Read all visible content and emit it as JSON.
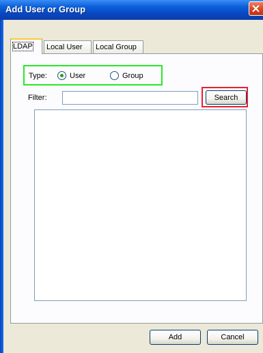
{
  "window": {
    "title": "Add User or Group"
  },
  "tabs": [
    {
      "label": "LDAP",
      "active": true
    },
    {
      "label": "Local User",
      "active": false
    },
    {
      "label": "Local Group",
      "active": false
    }
  ],
  "type_selector": {
    "label": "Type:",
    "options": [
      {
        "label": "User",
        "selected": true
      },
      {
        "label": "Group",
        "selected": false
      }
    ]
  },
  "filter": {
    "label": "Filter:",
    "value": "",
    "placeholder": ""
  },
  "buttons": {
    "search_label": "Search",
    "add_label": "Add",
    "cancel_label": "Cancel"
  },
  "results": {
    "items": []
  },
  "colors": {
    "highlight_type_group": "#27e827",
    "highlight_search_button": "#e8202a",
    "dialog_background": "#ece9d8",
    "titlebar": "#0a5fd8"
  },
  "icons": {
    "close": "close-icon"
  }
}
